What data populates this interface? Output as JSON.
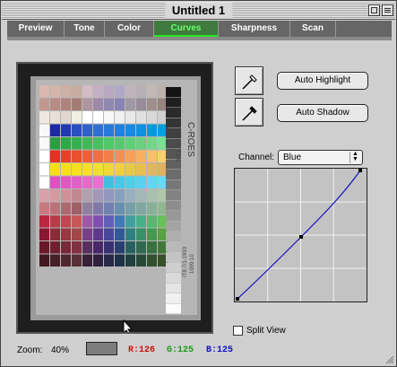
{
  "window": {
    "title": "Untitled 1"
  },
  "tabs": [
    {
      "label": "Preview",
      "active": false
    },
    {
      "label": "Tone",
      "active": false
    },
    {
      "label": "Color",
      "active": false
    },
    {
      "label": "Curves",
      "active": true
    },
    {
      "label": "Sharpness",
      "active": false
    },
    {
      "label": "Scan",
      "active": false
    }
  ],
  "preview": {
    "target_labels": {
      "line1": "C-ROES",
      "line2": "T2X",
      "line3": "IT8.7/1-1993",
      "line4": "1999:10"
    },
    "cursor": "arrow-pointer"
  },
  "controls": {
    "auto_highlight_label": "Auto Highlight",
    "auto_shadow_label": "Auto Shadow",
    "highlight_dropper_icon": "eyedropper-white-icon",
    "shadow_dropper_icon": "eyedropper-black-icon",
    "channel_label": "Channel:",
    "channel_value": "Blue",
    "split_view_label": "Split View",
    "split_view_checked": false
  },
  "status": {
    "zoom_label": "Zoom:",
    "zoom_value": "40%",
    "r_value": "R:126",
    "g_value": "G:125",
    "b_value": "B:125",
    "sample_color": "#7e7d7d"
  },
  "colors": {
    "active_tab_text": "#6aff6a",
    "curve": "#1010c0",
    "r_text": "#d01010",
    "g_text": "#1a9a1a",
    "b_text": "#1010d0"
  }
}
